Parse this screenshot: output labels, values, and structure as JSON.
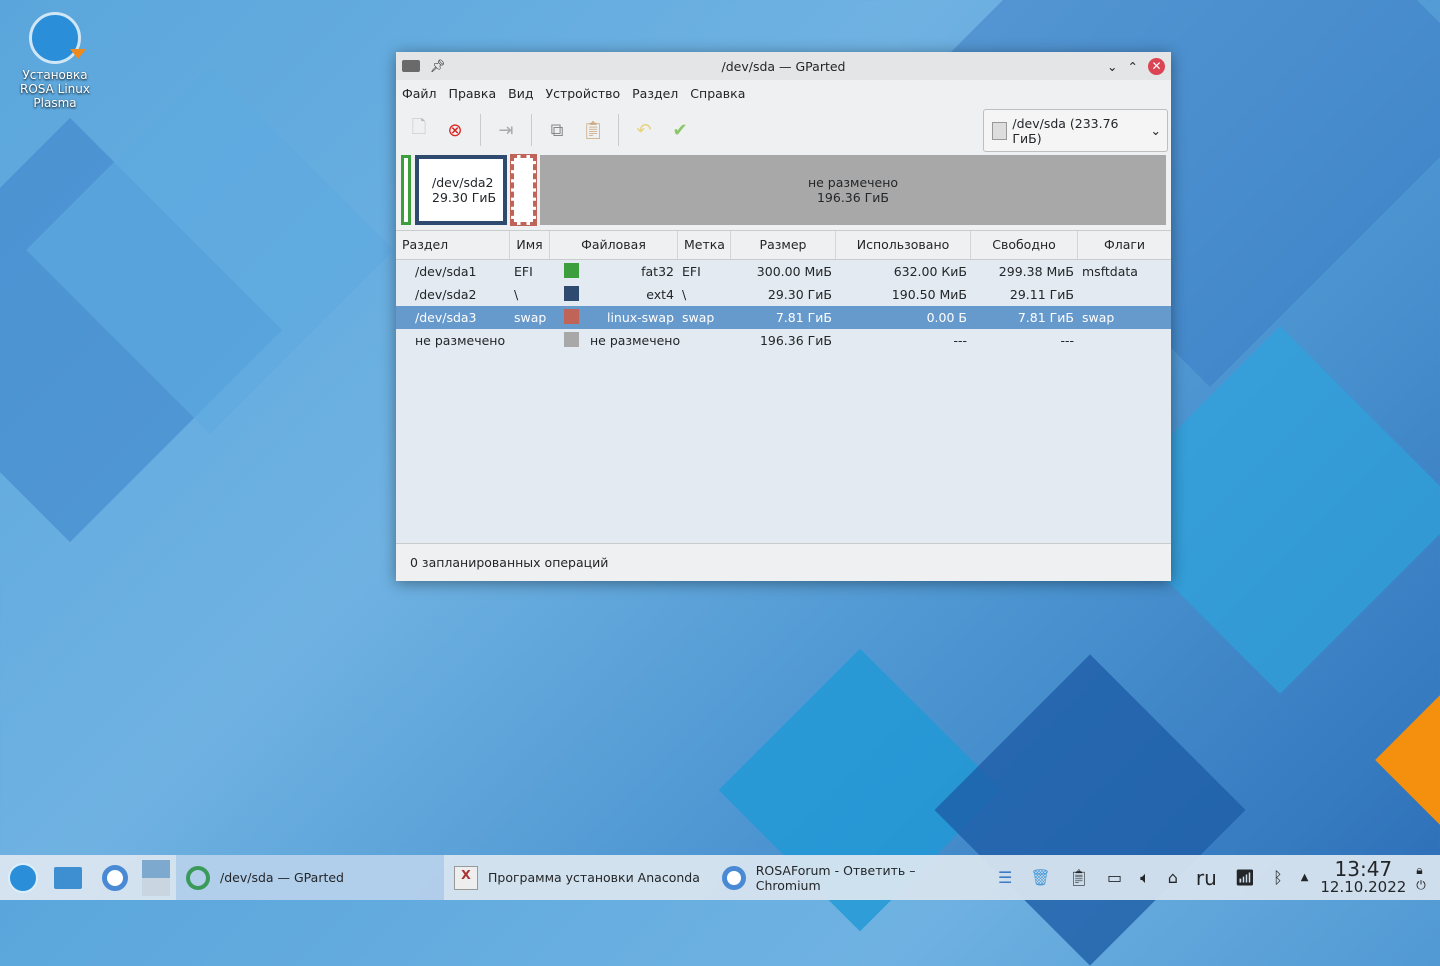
{
  "desktop": {
    "icon_label": "Установка ROSA Linux Plasma"
  },
  "window": {
    "title": "/dev/sda — GParted"
  },
  "menu": [
    "Файл",
    "Правка",
    "Вид",
    "Устройство",
    "Раздел",
    "Справка"
  ],
  "device_selector": "/dev/sda  (233.76 ГиБ)",
  "disk_map": {
    "sda2_name": "/dev/sda2",
    "sda2_size": "29.30 ГиБ",
    "unalloc_name": "не размечено",
    "unalloc_size": "196.36 ГиБ"
  },
  "columns": [
    "Раздел",
    "Имя",
    "Файловая система",
    "Метка",
    "Размер",
    "Использовано",
    "Свободно",
    "Флаги"
  ],
  "rows": [
    {
      "partition": "/dev/sda1",
      "name": "EFI",
      "color": "#3c9e3c",
      "fs": "fat32",
      "label": "EFI",
      "size": "300.00 МиБ",
      "used": "632.00 КиБ",
      "free": "299.38 МиБ",
      "flags": "msftdata"
    },
    {
      "partition": "/dev/sda2",
      "name": "\\",
      "color": "#2e4a6e",
      "fs": "ext4",
      "label": "\\",
      "size": "29.30 ГиБ",
      "used": "190.50 МиБ",
      "free": "29.11 ГиБ",
      "flags": ""
    },
    {
      "partition": "/dev/sda3",
      "name": "swap",
      "color": "#c0645a",
      "fs": "linux-swap",
      "label": "swap",
      "size": "7.81 ГиБ",
      "used": "0.00 Б",
      "free": "7.81 ГиБ",
      "flags": "swap"
    },
    {
      "partition": "не размечено",
      "name": "",
      "color": "#a8a8a8",
      "fs": "не размечено",
      "label": "",
      "size": "196.36 ГиБ",
      "used": "---",
      "free": "---",
      "flags": ""
    }
  ],
  "status": "0 запланированных операций",
  "taskbar": {
    "tasks": [
      "/dev/sda — GParted",
      "Программа установки Anaconda",
      "ROSAForum - Ответить – Chromium"
    ],
    "lang": "ru",
    "time": "13:47",
    "date": "12.10.2022"
  }
}
